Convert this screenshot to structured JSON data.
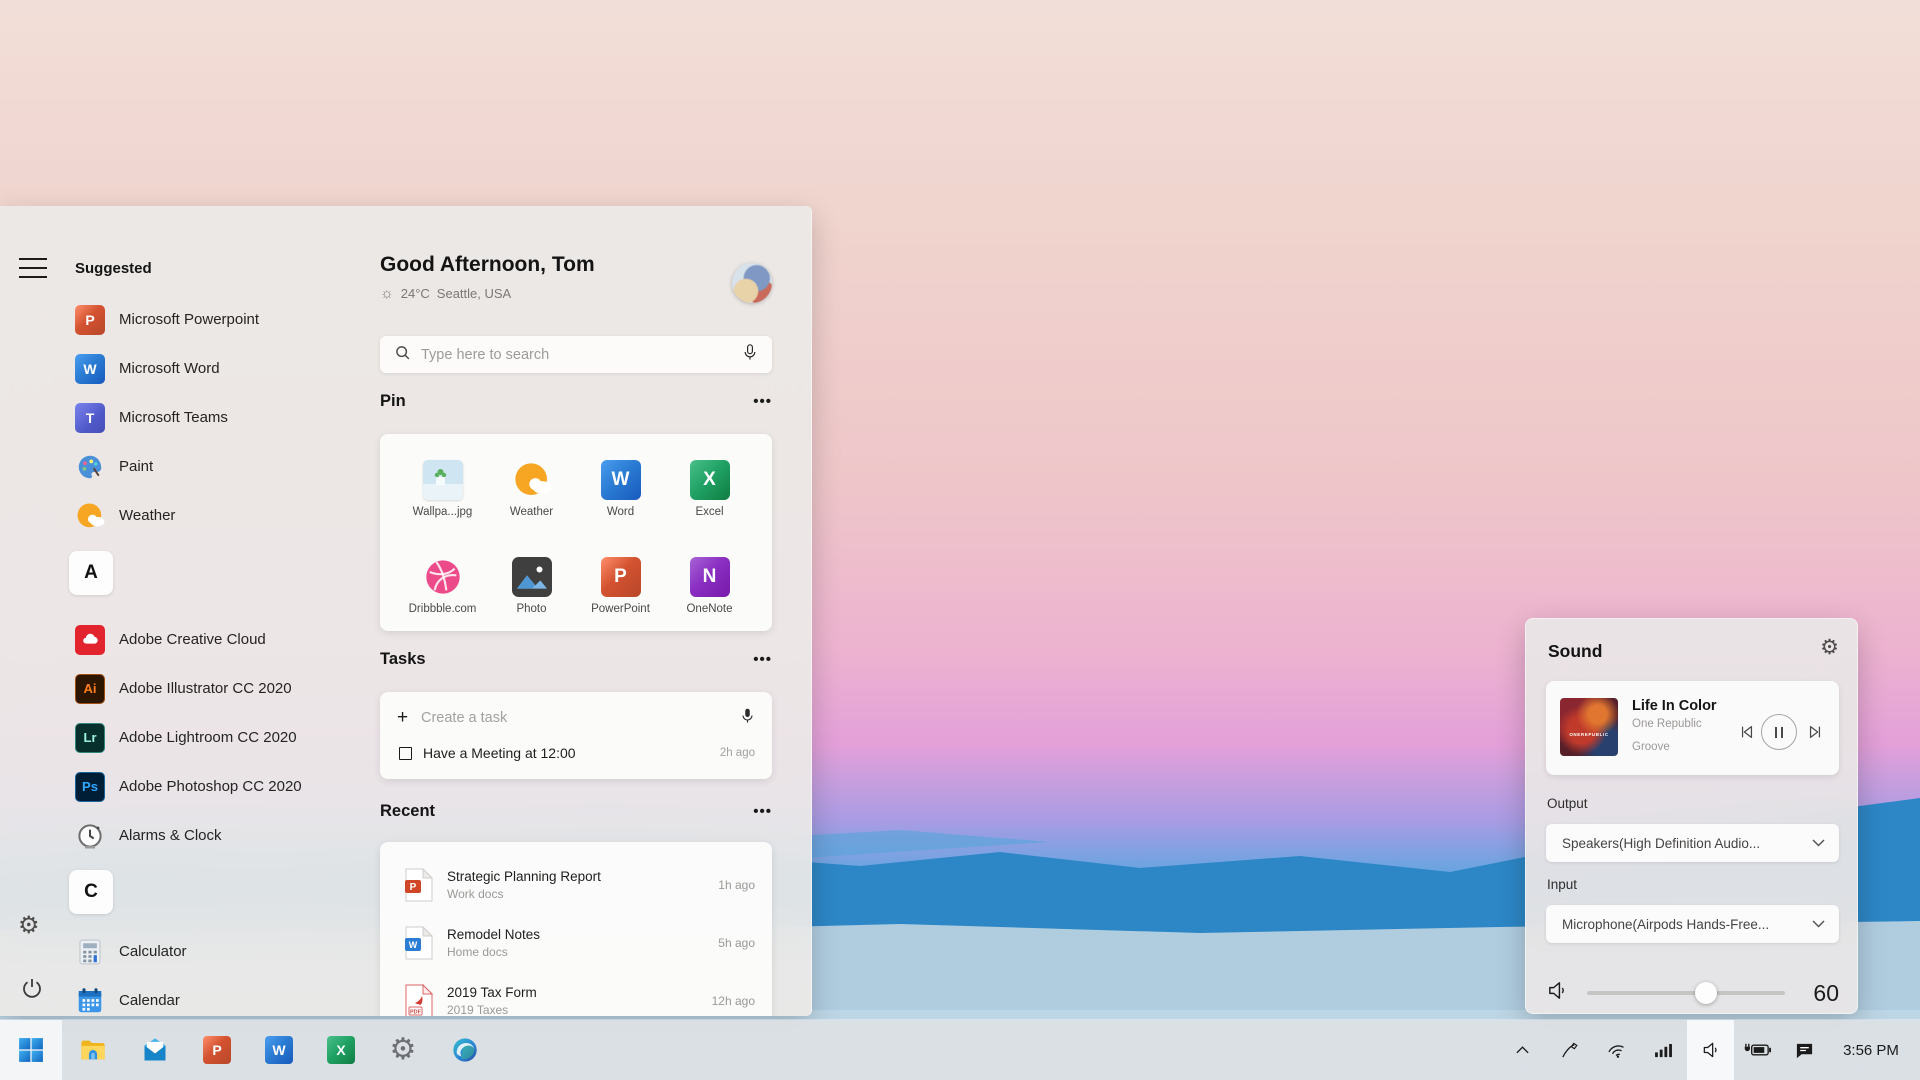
{
  "start_menu": {
    "suggested": {
      "header": "Suggested",
      "items": [
        {
          "label": "Microsoft Powerpoint",
          "icon": "powerpoint-icon",
          "letter": "P",
          "color": "#c43e1c"
        },
        {
          "label": "Microsoft Word",
          "icon": "word-icon",
          "letter": "W",
          "color": "#185abd"
        },
        {
          "label": "Microsoft Teams",
          "icon": "teams-icon",
          "letter": "T",
          "color": "#5059c9"
        },
        {
          "label": "Paint",
          "icon": "paint-icon"
        },
        {
          "label": "Weather",
          "icon": "weather-icon"
        }
      ]
    },
    "sections": [
      {
        "letter": "A",
        "items": [
          {
            "label": "Adobe Creative Cloud",
            "icon": "creative-cloud-icon",
            "color": "#e2242e"
          },
          {
            "label": "Adobe Illustrator CC 2020",
            "icon": "illustrator-icon",
            "letter": "Ai",
            "color": "#ff7c1e"
          },
          {
            "label": "Adobe Lightroom CC 2020",
            "icon": "lightroom-icon",
            "letter": "Lr",
            "color": "#9ef2e3"
          },
          {
            "label": "Adobe Photoshop CC 2020",
            "icon": "photoshop-icon",
            "letter": "Ps",
            "color": "#31a8ff"
          },
          {
            "label": "Alarms & Clock",
            "icon": "alarm-clock-icon"
          }
        ]
      },
      {
        "letter": "C",
        "items": [
          {
            "label": "Calculator",
            "icon": "calculator-icon"
          },
          {
            "label": "Calendar",
            "icon": "calendar-icon"
          }
        ]
      }
    ]
  },
  "header": {
    "greeting": "Good Afternoon, Tom",
    "temperature": "24°C",
    "location": "Seattle, USA",
    "weather_glyph": "☼"
  },
  "search": {
    "placeholder": "Type here to search"
  },
  "pin": {
    "title": "Pin",
    "more": "•••",
    "tiles": [
      {
        "label": "Wallpa...jpg",
        "icon": "image-thumbnail-icon"
      },
      {
        "label": "Weather",
        "icon": "weather-icon"
      },
      {
        "label": "Word",
        "icon": "word-icon",
        "letter": "W"
      },
      {
        "label": "Excel",
        "icon": "excel-icon",
        "letter": "X"
      },
      {
        "label": "Dribbble.com",
        "icon": "dribbble-icon"
      },
      {
        "label": "Photo",
        "icon": "photos-icon"
      },
      {
        "label": "PowerPoint",
        "icon": "powerpoint-icon",
        "letter": "P"
      },
      {
        "label": "OneNote",
        "icon": "onenote-icon",
        "letter": "N"
      }
    ]
  },
  "tasks": {
    "title": "Tasks",
    "more": "•••",
    "create_placeholder": "Create a task",
    "items": [
      {
        "label": "Have a Meeting at 12:00",
        "time": "2h ago"
      }
    ]
  },
  "recent": {
    "title": "Recent",
    "more": "•••",
    "items": [
      {
        "title": "Strategic Planning Report",
        "subtitle": "Work docs",
        "time": "1h ago",
        "icon": "powerpoint-file-icon",
        "letter": "P"
      },
      {
        "title": "Remodel Notes",
        "subtitle": "Home docs",
        "time": "5h ago",
        "icon": "word-file-icon",
        "letter": "W"
      },
      {
        "title": "2019 Tax Form",
        "subtitle": "2019 Taxes",
        "time": "12h ago",
        "icon": "pdf-file-icon",
        "letter": "PDF"
      }
    ]
  },
  "sound": {
    "title": "Sound",
    "media": {
      "title": "Life In Color",
      "artist": "One Republic",
      "source": "Groove",
      "album_text": "ONEREPUBLIC"
    },
    "output_label": "Output",
    "output_value": "Speakers(High Definition Audio...",
    "input_label": "Input",
    "input_value": "Microphone(Airpods Hands-Free...",
    "volume": "60"
  },
  "taskbar": {
    "apps": [
      {
        "name": "start"
      },
      {
        "name": "file-explorer"
      },
      {
        "name": "mail"
      },
      {
        "name": "powerpoint",
        "letter": "P"
      },
      {
        "name": "word",
        "letter": "W"
      },
      {
        "name": "excel",
        "letter": "X"
      },
      {
        "name": "settings"
      },
      {
        "name": "edge"
      }
    ],
    "clock": "3:56 PM"
  }
}
